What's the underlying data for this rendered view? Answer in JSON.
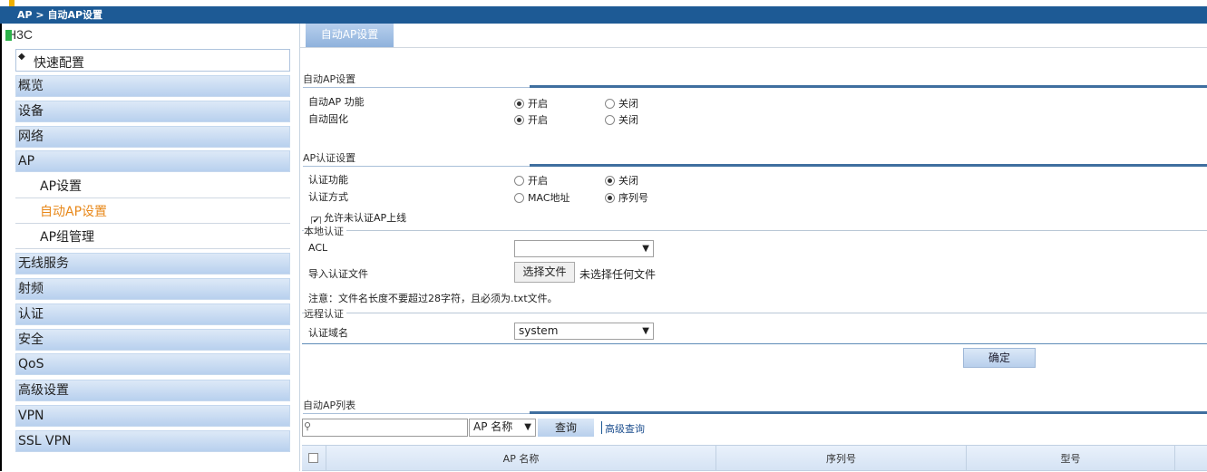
{
  "breadcrumb": "AP > 自动AP设置",
  "sidebar": {
    "brand": "H3C",
    "quick": "快速配置",
    "items": [
      {
        "label": "概览"
      },
      {
        "label": "设备"
      },
      {
        "label": "网络"
      },
      {
        "label": "AP"
      }
    ],
    "sub_items": [
      {
        "label": "AP设置",
        "active": false
      },
      {
        "label": "自动AP设置",
        "active": true
      },
      {
        "label": "AP组管理",
        "active": false
      }
    ],
    "items2": [
      {
        "label": "无线服务"
      },
      {
        "label": "射频"
      },
      {
        "label": "认证"
      },
      {
        "label": "安全"
      },
      {
        "label": "QoS"
      },
      {
        "label": "高级设置"
      },
      {
        "label": "VPN"
      },
      {
        "label": "SSL VPN"
      }
    ]
  },
  "tab": "自动AP设置",
  "auto_ap": {
    "title": "自动AP设置",
    "rows": [
      {
        "label": "自动AP 功能",
        "opt1": "开启",
        "opt2": "关闭",
        "selected": 1
      },
      {
        "label": "自动固化",
        "opt1": "开启",
        "opt2": "关闭",
        "selected": 1
      }
    ]
  },
  "ap_auth": {
    "title": "AP认证设置",
    "rows": [
      {
        "label": "认证功能",
        "opt1": "开启",
        "opt2": "关闭",
        "selected": 2
      },
      {
        "label": "认证方式",
        "opt1": "MAC地址",
        "opt2": "序列号",
        "selected": 2
      }
    ],
    "allow_unauth": "允许未认证AP上线",
    "allow_checked": true
  },
  "local_auth": {
    "legend": "本地认证",
    "acl_label": "ACL",
    "acl_value": "",
    "import_label": "导入认证文件",
    "file_button": "选择文件",
    "file_status": "未选择任何文件",
    "note": "注意：文件名长度不要超过28字符，且必须为.txt文件。"
  },
  "remote_auth": {
    "legend": "远程认证",
    "domain_label": "认证域名",
    "domain_value": "system"
  },
  "ok_button": "确定",
  "ap_list": {
    "title": "自动AP列表",
    "search_placeholder": "",
    "filter_value": "AP 名称",
    "query_button": "查询",
    "advanced": "高级查询",
    "columns": [
      "AP 名称",
      "序列号",
      "型号"
    ]
  }
}
